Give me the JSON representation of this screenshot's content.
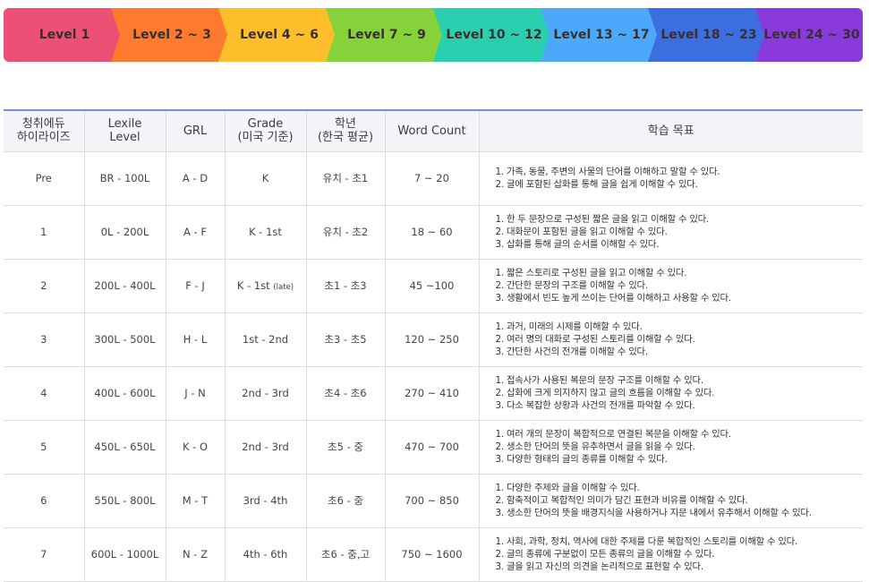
{
  "levels": [
    {
      "label": "Level 1",
      "color": "#ee4f74"
    },
    {
      "label": "Level 2 ~ 3",
      "color": "#fd7a2e"
    },
    {
      "label": "Level 4 ~ 6",
      "color": "#fdbe2b"
    },
    {
      "label": "Level 7 ~ 9",
      "color": "#86d23a"
    },
    {
      "label": "Level 10 ~ 12",
      "color": "#29cfae"
    },
    {
      "label": "Level 13 ~ 17",
      "color": "#4ba8fb"
    },
    {
      "label": "Level 18 ~ 23",
      "color": "#3b6ee0"
    },
    {
      "label": "Level 24 ~ 30",
      "color": "#8939dc"
    }
  ],
  "table": {
    "header_border_color": "#7d8be4",
    "headers": [
      {
        "line1": "청취에듀",
        "line2": "하이라이즈"
      },
      {
        "line1": "Lexile",
        "line2": "Level"
      },
      {
        "line1": "GRL",
        "line2": ""
      },
      {
        "line1": "Grade",
        "line2": "(미국 기준)"
      },
      {
        "line1": "학년",
        "line2": "(한국 평균)"
      },
      {
        "line1": "Word Count",
        "line2": ""
      },
      {
        "line1": "학습 목표",
        "line2": ""
      }
    ],
    "rows": [
      {
        "level": "Pre",
        "lexile": "BR - 100L",
        "grl": "A - D",
        "grade": "K",
        "grade_note": "",
        "korea": "유치 - 초1",
        "words": "7 ~ 20",
        "goals": [
          "1. 가족, 동물, 주변의 사물의 단어를 이해하고 말할 수 있다.",
          "2. 글에 포함된 삽화를 통해 글을 쉽게 이해할 수 있다."
        ]
      },
      {
        "level": "1",
        "lexile": "0L - 200L",
        "grl": "A - F",
        "grade": "K - 1st",
        "grade_note": "",
        "korea": "유치 - 초2",
        "words": "18 ~ 60",
        "goals": [
          "1. 한 두 문장으로 구성된 짧은 글을 읽고 이해할 수 있다.",
          "2. 대화문이 포함된 글을 읽고 이해할 수 있다.",
          "3. 삽화를 통해 글의 순서를 이해할 수 있다."
        ]
      },
      {
        "level": "2",
        "lexile": "200L - 400L",
        "grl": "F - J",
        "grade": "K - 1st",
        "grade_note": "(late)",
        "korea": "초1 - 초3",
        "words": "45 ~100",
        "goals": [
          "1. 짧은 스토리로 구성된 글을 읽고 이해할 수 있다.",
          "2. 간단한 문장의 구조를 이해할 수 있다.",
          "3. 생활에서 빈도 높게 쓰이는 단어를 이해하고 사용할 수 있다."
        ]
      },
      {
        "level": "3",
        "lexile": "300L - 500L",
        "grl": "H - L",
        "grade": "1st - 2nd",
        "grade_note": "",
        "korea": "초3 - 초5",
        "words": "120 ~ 250",
        "goals": [
          "1. 과거, 미래의 시제를 이해할 수 있다.",
          "2. 여러 명의 대화로 구성된 스토리를 이해할 수 있다.",
          "3. 간단한 사건의 전개를 이해할 수 있다."
        ]
      },
      {
        "level": "4",
        "lexile": "400L - 600L",
        "grl": "J - N",
        "grade": "2nd - 3rd",
        "grade_note": "",
        "korea": "초4 - 초6",
        "words": "270 ~ 410",
        "goals": [
          "1. 접속사가 사용된 복문의 문장 구조를 이해할 수 있다.",
          "2. 삽화에 크게 의지하지 않고 글의 흐름을 이해할 수 있다.",
          "3. 다소 복잡한 상황과 사건의 전개를 파악할 수 있다."
        ]
      },
      {
        "level": "5",
        "lexile": "450L - 650L",
        "grl": "K - O",
        "grade": "2nd - 3rd",
        "grade_note": "",
        "korea": "초5 - 중",
        "words": "470 ~ 700",
        "goals": [
          "1. 여러 개의 문장이 복합적으로 연결된 복문을 이해할 수 있다.",
          "2. 생소한 단어의 뜻을 유추하면서 글을 읽을 수 있다.",
          "3. 다양한 형태의 글의 종류를 이해할 수 있다."
        ]
      },
      {
        "level": "6",
        "lexile": "550L - 800L",
        "grl": "M - T",
        "grade": "3rd - 4th",
        "grade_note": "",
        "korea": "초6 - 중",
        "words": "700 ~ 850",
        "goals": [
          "1. 다양한 주제와 글을 이해할 수 있다.",
          "2. 함축적이고 복합적인 의미가 담긴 표현과 비유를 이해할 수 있다.",
          "3. 생소한 단어의 뜻을 배경지식을 사용하거나 지문 내에서 유추해서 이해할 수 있다."
        ]
      },
      {
        "level": "7",
        "lexile": "600L - 1000L",
        "grl": "N - Z",
        "grade": "4th - 6th",
        "grade_note": "",
        "korea": "초6 - 중,고",
        "words": "750 ~ 1600",
        "goals": [
          "1. 사회, 과학, 정치, 역사에 대한 주제를 다룬 복합적인 스토리를 이해할 수 있다.",
          "2. 글의 종류에 구분없이 모든 종류의 글을 이해할 수 있다.",
          "3. 글을 읽고 자신의 의견을 논리적으로 표현할 수 있다."
        ]
      }
    ]
  }
}
